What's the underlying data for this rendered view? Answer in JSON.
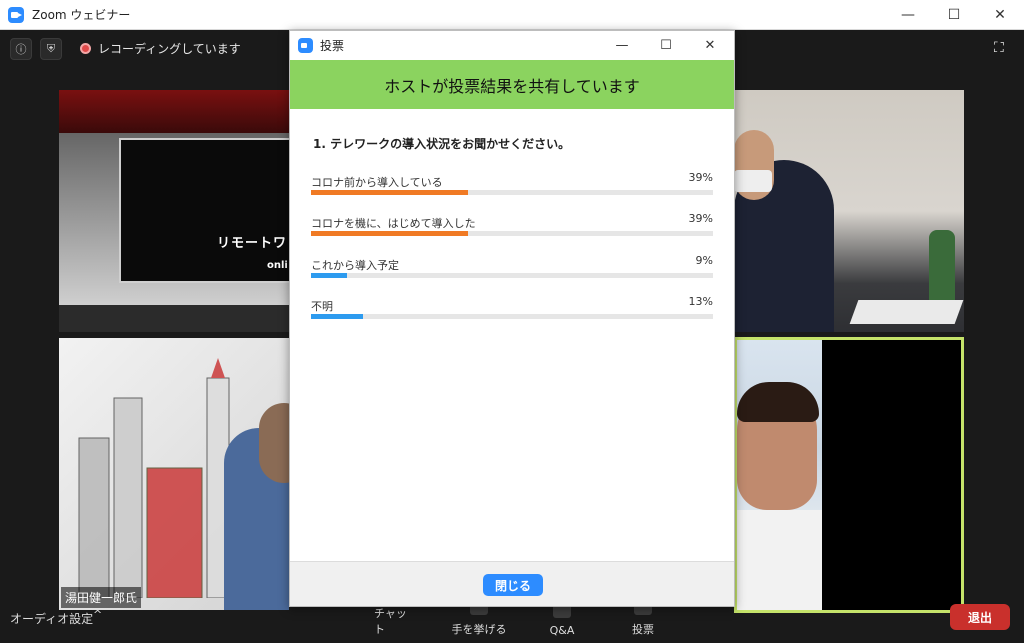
{
  "window": {
    "title": "Zoom ウェビナー",
    "minimize": "—",
    "maximize": "☐",
    "close": "✕"
  },
  "meeting": {
    "recording_text": "レコーディングしています",
    "info_icon": "ⓘ",
    "shield_icon": "⛨",
    "fullscreen_icon": "⛶",
    "poster_text_main": "リモートワ",
    "poster_text_sub": "onli",
    "participant_name": "湯田健一郎氏"
  },
  "toolbar": {
    "audio_settings": "オーディオ設定",
    "audio_chevron": "^",
    "chat": "チャット",
    "raise_hand": "手を挙げる",
    "qa": "Q&A",
    "poll": "投票",
    "leave": "退出"
  },
  "poll": {
    "title": "投票",
    "minimize": "—",
    "maximize": "☐",
    "close": "✕",
    "banner": "ホストが投票結果を共有しています",
    "question": "1. テレワークの導入状況をお聞かせください。",
    "answers": [
      {
        "label": "コロナ前から導入している",
        "percent_text": "39%",
        "value": 39,
        "color": "#f07a24"
      },
      {
        "label": "コロナを機に、はじめて導入した",
        "percent_text": "39%",
        "value": 39,
        "color": "#f07a24"
      },
      {
        "label": "これから導入予定",
        "percent_text": "9%",
        "value": 9,
        "color": "#2d9bef"
      },
      {
        "label": "不明",
        "percent_text": "13%",
        "value": 13,
        "color": "#2d9bef"
      }
    ],
    "close_button": "閉じる"
  },
  "colors": {
    "accent": "#2d8cff",
    "banner": "#8bd35f",
    "leave": "#c9302c",
    "active_speaker_border": "#c5e36a"
  }
}
